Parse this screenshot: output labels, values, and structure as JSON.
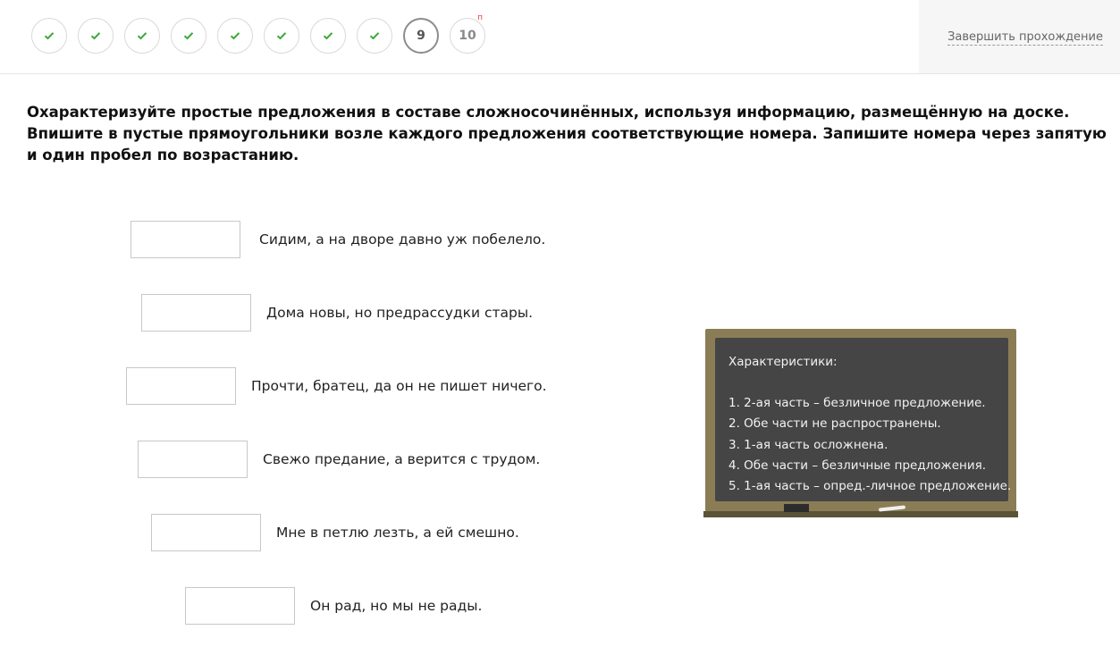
{
  "progress": {
    "steps": [
      {
        "label": "",
        "state": "done"
      },
      {
        "label": "",
        "state": "done"
      },
      {
        "label": "",
        "state": "done"
      },
      {
        "label": "",
        "state": "done"
      },
      {
        "label": "",
        "state": "done"
      },
      {
        "label": "",
        "state": "done"
      },
      {
        "label": "",
        "state": "done"
      },
      {
        "label": "",
        "state": "done"
      },
      {
        "label": "9",
        "state": "current"
      },
      {
        "label": "10",
        "state": "pending",
        "badge": "п"
      }
    ],
    "check_icon": "check-icon",
    "check_color": "#3aa83a"
  },
  "header": {
    "finish_label": "Завершить прохождение"
  },
  "task": {
    "instruction": "Охарактеризуйте простые предложения в составе сложносочинённых, используя информацию, размещённую на доске. Впишите в пустые прямоугольники возле каждого предложения соответствующие номера. Запишите номера через запятую и один пробел по возрастанию.",
    "sentences": [
      {
        "answer": "",
        "text": "Сидим, а на дворе давно уж побелело."
      },
      {
        "answer": "",
        "text": "Дома новы, но предрассудки стары."
      },
      {
        "answer": "",
        "text": "Прочти, братец, да он не пишет ничего."
      },
      {
        "answer": "",
        "text": "Свежо предание, а верится с трудом."
      },
      {
        "answer": "",
        "text": "Мне в петлю лезть, а ей смешно."
      },
      {
        "answer": "",
        "text": "Он рад, но мы не рады."
      }
    ]
  },
  "board": {
    "title": "Характеристики:",
    "items": [
      "1. 2-ая часть – безличное предложение.",
      "2. Обе части не распространены.",
      "3. 1-ая часть осложнена.",
      "4. Обе части – безличные предложения.",
      "5. 1-ая часть – опред.-личное предложение."
    ]
  }
}
